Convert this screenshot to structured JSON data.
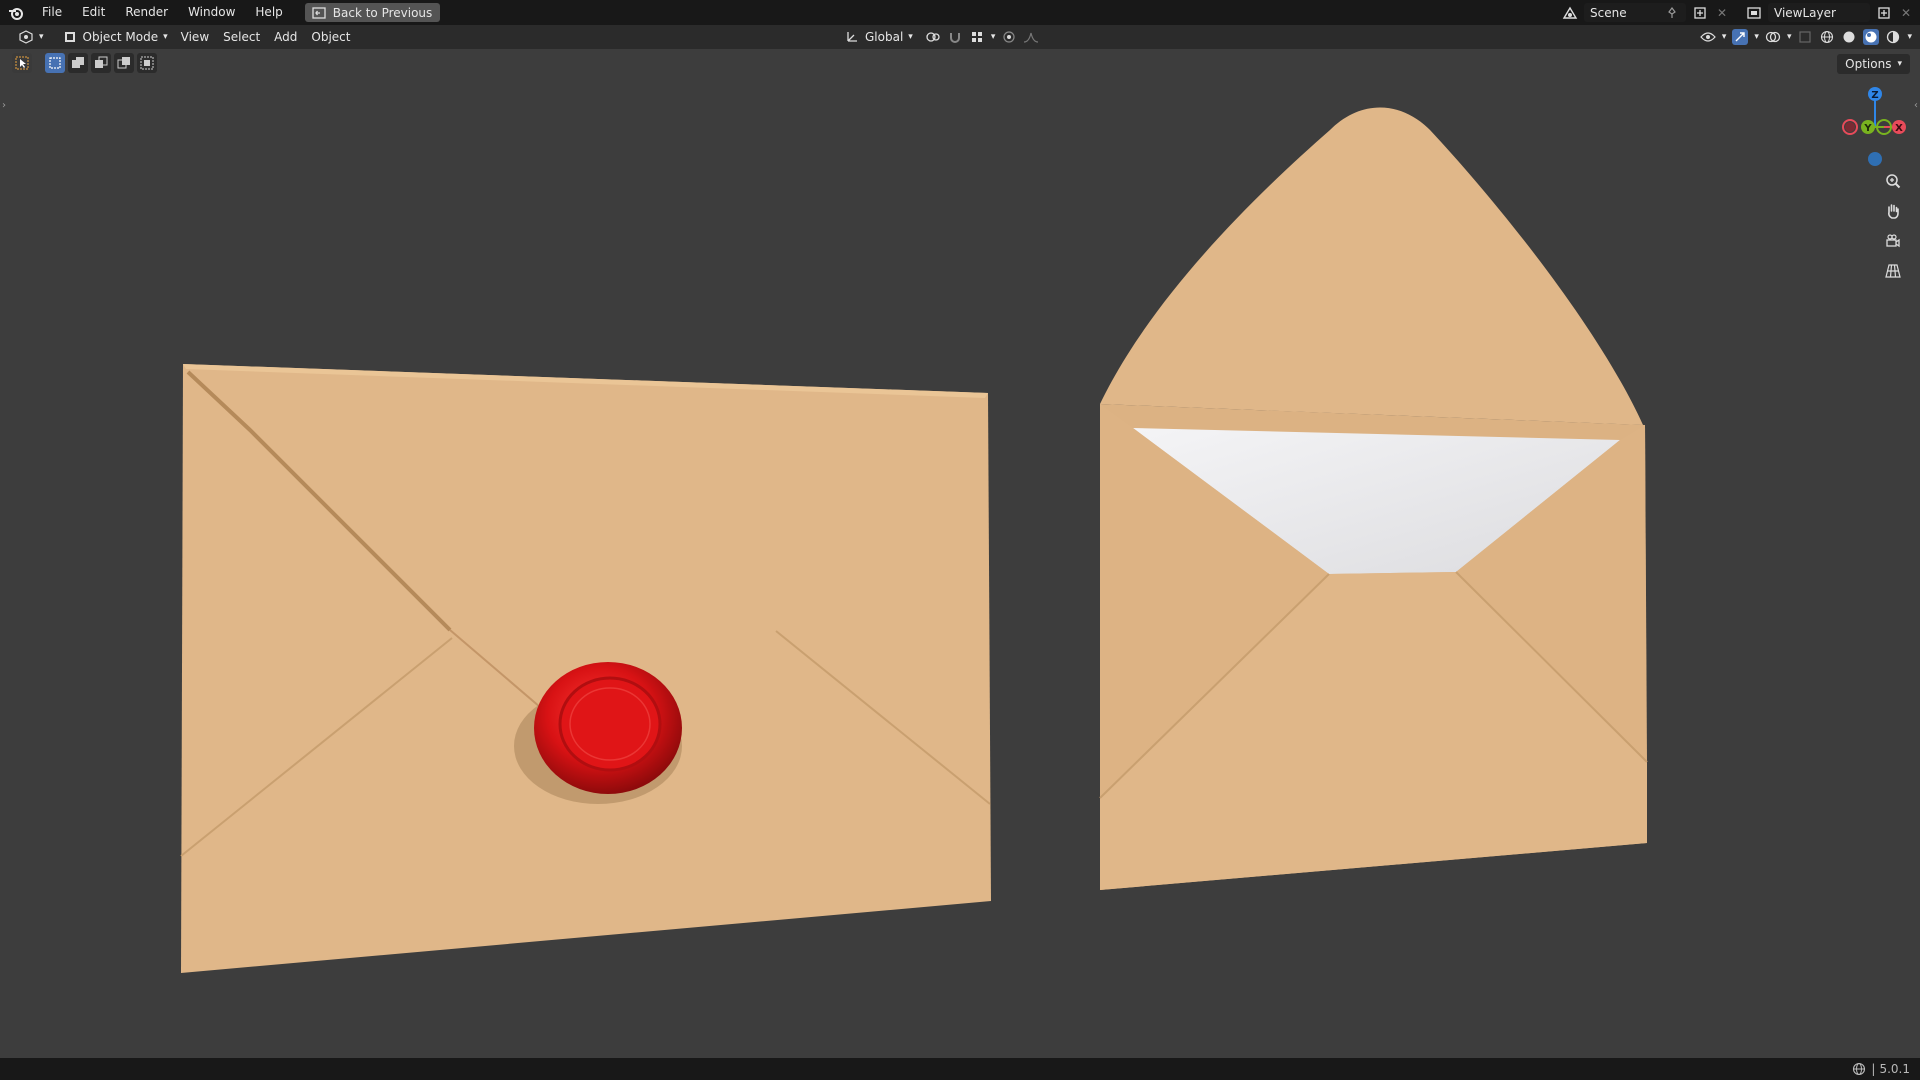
{
  "topbar": {
    "menus": [
      "File",
      "Edit",
      "Render",
      "Window",
      "Help"
    ],
    "back_button": "Back to Previous",
    "scene_name": "Scene",
    "view_layer": "ViewLayer"
  },
  "header": {
    "mode": "Object Mode",
    "menus": [
      "View",
      "Select",
      "Add",
      "Object"
    ],
    "transform_orientation": "Global",
    "options_label": "Options"
  },
  "gizmo": {
    "axes": [
      "Z",
      "Y",
      "X"
    ],
    "colors": {
      "x": "#e84b5a",
      "y": "#79b31f",
      "z": "#2f86e8",
      "neg_z": "#2f6fb3"
    }
  },
  "status": {
    "version": "5.0.1"
  },
  "scene": {
    "envelope_color": "#e0b789",
    "envelope_shade": "#d3a978",
    "seal_color": "#d81214",
    "letter_color": "#eeeeee"
  }
}
